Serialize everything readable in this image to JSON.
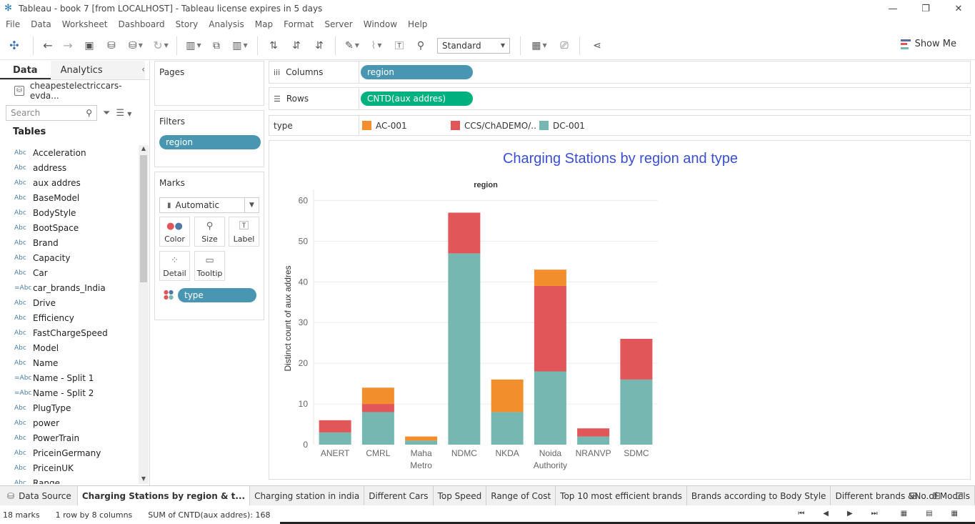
{
  "window": {
    "title": "Tableau - book 7 [from LOCALHOST] - Tableau license expires in 5 days",
    "controls": {
      "minimize": "—",
      "restore": "❐",
      "close": "✕"
    }
  },
  "menu": [
    "File",
    "Data",
    "Worksheet",
    "Dashboard",
    "Story",
    "Analysis",
    "Map",
    "Format",
    "Server",
    "Window",
    "Help"
  ],
  "toolbar": {
    "fit_select": "Standard",
    "show_me": "Show Me"
  },
  "left_pane": {
    "tab_data": "Data",
    "tab_analytics": "Analytics",
    "datasource": "cheapestelectriccars-evda...",
    "search_placeholder": "Search",
    "tables_heading": "Tables",
    "fields": [
      {
        "type": "Abc",
        "name": "Acceleration"
      },
      {
        "type": "Abc",
        "name": "address"
      },
      {
        "type": "Abc",
        "name": "aux addres"
      },
      {
        "type": "Abc",
        "name": "BaseModel"
      },
      {
        "type": "Abc",
        "name": "BodyStyle"
      },
      {
        "type": "Abc",
        "name": "BootSpace"
      },
      {
        "type": "Abc",
        "name": "Brand"
      },
      {
        "type": "Abc",
        "name": "Capacity"
      },
      {
        "type": "Abc",
        "name": "Car"
      },
      {
        "type": "=Abc",
        "name": "car_brands_India"
      },
      {
        "type": "Abc",
        "name": "Drive"
      },
      {
        "type": "Abc",
        "name": "Efficiency"
      },
      {
        "type": "Abc",
        "name": "FastChargeSpeed"
      },
      {
        "type": "Abc",
        "name": "Model"
      },
      {
        "type": "Abc",
        "name": "Name"
      },
      {
        "type": "=Abc",
        "name": "Name - Split 1"
      },
      {
        "type": "=Abc",
        "name": "Name - Split 2"
      },
      {
        "type": "Abc",
        "name": "PlugType"
      },
      {
        "type": "Abc",
        "name": "power"
      },
      {
        "type": "Abc",
        "name": "PowerTrain"
      },
      {
        "type": "Abc",
        "name": "PriceinGermany"
      },
      {
        "type": "Abc",
        "name": "PriceinUK"
      },
      {
        "type": "Abc",
        "name": "Range"
      }
    ]
  },
  "cards": {
    "pages": "Pages",
    "filters": "Filters",
    "filter_pill": "region",
    "marks": "Marks",
    "mark_type": "Automatic",
    "buttons": {
      "color": "Color",
      "size": "Size",
      "label": "Label",
      "detail": "Detail",
      "tooltip": "Tooltip"
    },
    "color_pill": "type"
  },
  "shelves": {
    "columns_label": "Columns",
    "columns_pill": "region",
    "rows_label": "Rows",
    "rows_pill": "CNTD(aux addres)"
  },
  "legend": {
    "title": "type",
    "items": [
      {
        "label": "AC-001",
        "color": "#f28e2b"
      },
      {
        "label": "CCS/ChADEMO/..",
        "color": "#e15759"
      },
      {
        "label": "DC-001",
        "color": "#76b7b2"
      }
    ]
  },
  "chart_data": {
    "type": "bar",
    "title": "Charging Stations by region and type",
    "header": "region",
    "ylabel": "Distinct count of aux addres",
    "ylim": [
      0,
      62
    ],
    "yticks": [
      0,
      10,
      20,
      30,
      40,
      50,
      60
    ],
    "categories": [
      "ANERT",
      "CMRL",
      "Maha Metro",
      "NDMC",
      "NKDA",
      "Noida Authority",
      "NRANVP",
      "SDMC"
    ],
    "category_lines": [
      [
        "ANERT"
      ],
      [
        "CMRL"
      ],
      [
        "Maha",
        "Metro"
      ],
      [
        "NDMC"
      ],
      [
        "NKDA"
      ],
      [
        "Noida",
        "Authority"
      ],
      [
        "NRANVP"
      ],
      [
        "SDMC"
      ]
    ],
    "series": [
      {
        "name": "DC-001",
        "color": "#76b7b2",
        "values": [
          3,
          8,
          1,
          47,
          8,
          18,
          2,
          16
        ]
      },
      {
        "name": "CCS/ChADEMO/..",
        "color": "#e15759",
        "values": [
          3,
          2,
          0,
          10,
          0,
          21,
          2,
          10
        ]
      },
      {
        "name": "AC-001",
        "color": "#f28e2b",
        "values": [
          0,
          4,
          1,
          0,
          8,
          4,
          0,
          0
        ]
      }
    ]
  },
  "sheet_tabs": {
    "data_source": "Data Source",
    "tabs": [
      "Charging Stations by region & t...",
      "Charging station in india",
      "Different Cars",
      "Top Speed",
      "Range of Cost",
      "Top 10 most efficient brands",
      "Brands according to Body Style",
      "Different brands &No.of Models"
    ]
  },
  "status": {
    "marks": "18 marks",
    "rows_cols": "1 row by 8 columns",
    "sum": "SUM of CNTD(aux addres): 168"
  }
}
